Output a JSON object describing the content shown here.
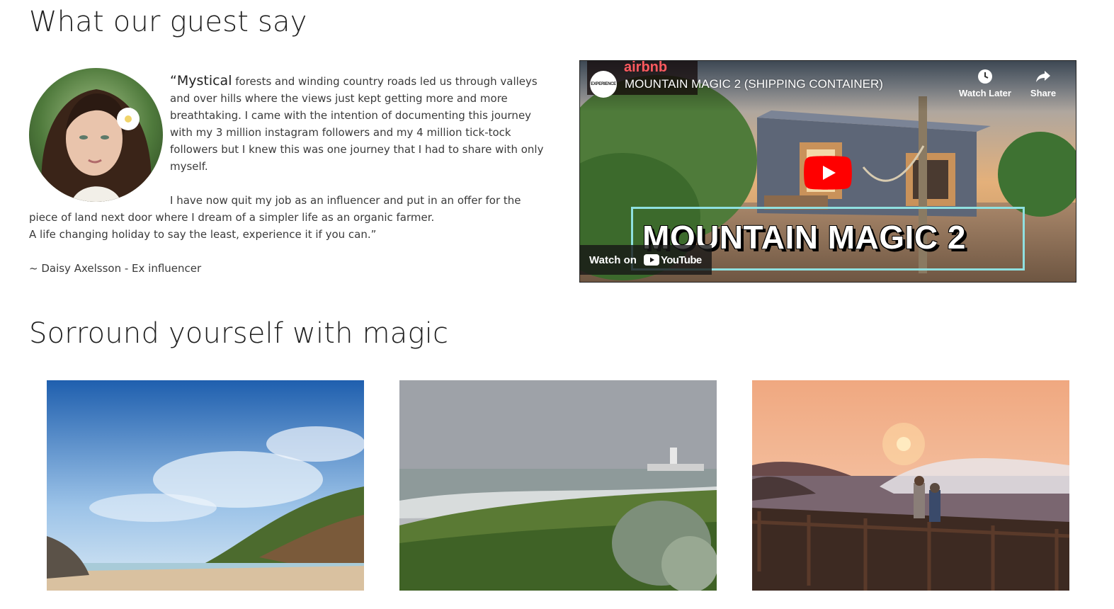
{
  "testimonial_section": {
    "heading": "What our guest say",
    "quote_lead": "“Mystical",
    "quote_p1_rest": " forests and winding country roads led us through valleys and over hills where the views just kept getting more and more breathtaking. I came with the intention of documenting this journey with my 3 million instagram followers and my 4 million tick-tock followers but I knew this was one journey that I had to share with only myself.",
    "quote_p2": "I have now quit my job as an influencer and put in an offer for the piece of land next door where I dream of a simpler life as an organic farmer.",
    "quote_p3": "A life changing holiday to say the least, experience it if you can.”",
    "author": "~ Daisy Axelsson - Ex influencer"
  },
  "video": {
    "title": "MOUNTAIN MAGIC 2 (SHIPPING CONTAINER)",
    "channel_logo_text": "EXPERIENCE",
    "airbnb_text": "airbnb",
    "watch_later_label": "Watch Later",
    "share_label": "Share",
    "watch_on_label": "Watch on",
    "youtube_word": "YouTube",
    "thumbnail_banner_text": "MOUNTAIN MAGIC 2"
  },
  "gallery_section": {
    "heading": "Sorround yourself with magic",
    "images": [
      "beach-cliffs-photo",
      "coastal-dunes-photo",
      "sunset-boardwalk-photo"
    ]
  },
  "colors": {
    "youtube_red": "#ff0000",
    "airbnb_red": "#ff5a5f",
    "banner_border": "#8fe0e0"
  }
}
